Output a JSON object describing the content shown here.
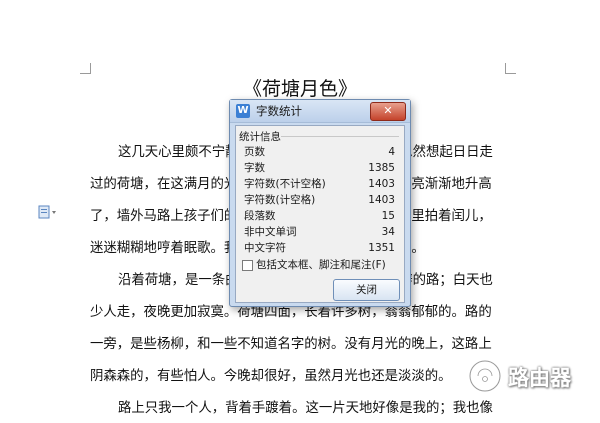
{
  "document": {
    "title": "《荷塘月色》",
    "lines": [
      "这几天心里颇不宁静。今晚在院子里坐着乘凉，忽然想起日日走",
      "过的荷塘，在这满月的光里，总该另有一番样子吧。月亮渐渐地升高",
      "了，墙外马路上孩子们的欢笑，已经听不见了；妻在屋里拍着闰儿，",
      "迷迷糊糊地哼着眠歌。我悄悄地披了大衫，带上门出去。",
      "沿着荷塘，是一条曲折的小煤屑路。这是一条幽僻的路；白天也",
      "少人走，夜晚更加寂寞。荷塘四面，长着许多树，蓊蓊郁郁的。路的",
      "一旁，是些杨柳，和一些不知道名字的树。没有月光的晚上，这路上",
      "阴森森的，有些怕人。今晚却很好，虽然月光也还是淡淡的。",
      "路上只我一个人，背着手踱着。这一片天地好像是我的；我也像"
    ]
  },
  "dialog": {
    "title": "字数统计",
    "app_icon_letter": "W",
    "close_glyph": "✕",
    "group_label": "统计信息",
    "stats": [
      {
        "label": "页数",
        "value": "4"
      },
      {
        "label": "字数",
        "value": "1385"
      },
      {
        "label": "字符数(不计空格)",
        "value": "1403"
      },
      {
        "label": "字符数(计空格)",
        "value": "1403"
      },
      {
        "label": "段落数",
        "value": "15"
      },
      {
        "label": "非中文单词",
        "value": "34"
      },
      {
        "label": "中文字符",
        "value": "1351"
      }
    ],
    "checkbox_label": "包括文本框、脚注和尾注(F)",
    "checkbox_checked": false,
    "close_button": "关闭"
  },
  "watermark": {
    "text": "路由器",
    "icon": "router-logo-icon"
  },
  "icons": {
    "side_toolbar": "document-options-icon"
  },
  "colors": {
    "dialog_bg": "#c9daef",
    "close_red": "#c4432b",
    "app_icon_blue": "#3b7fd4"
  }
}
